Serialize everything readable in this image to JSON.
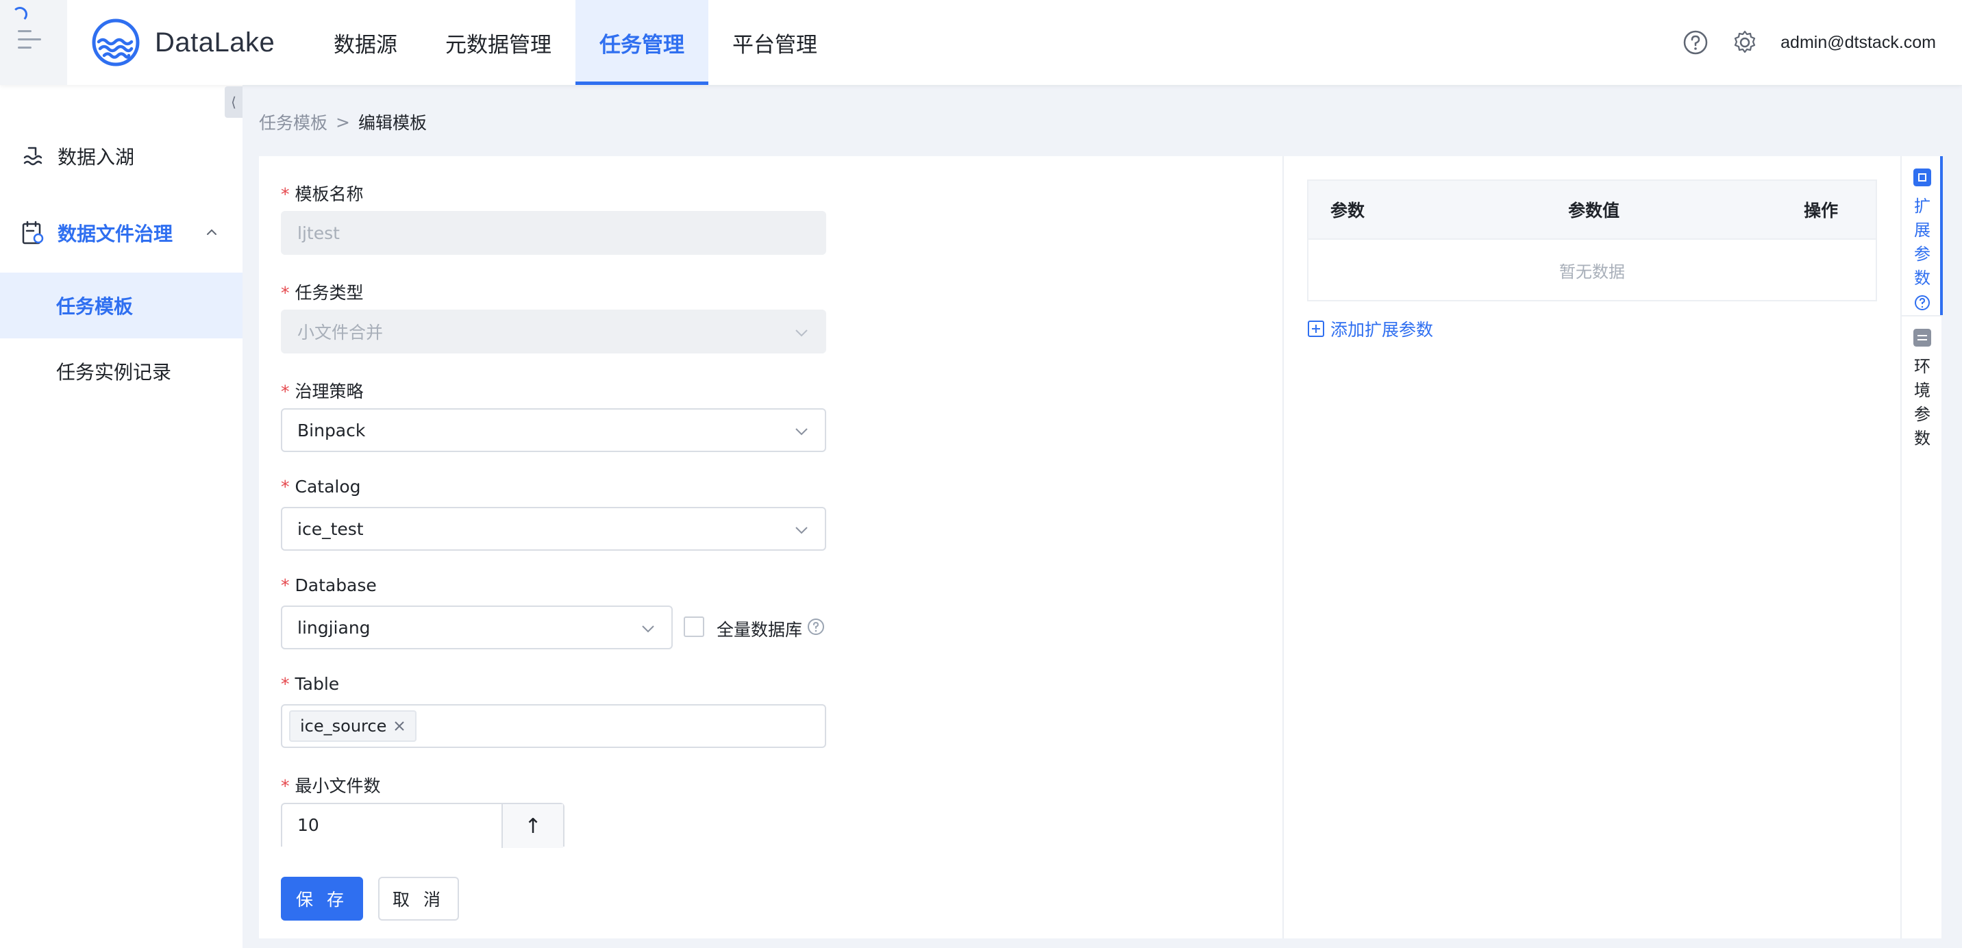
{
  "app": {
    "brand": "DataLake"
  },
  "nav": [
    {
      "label": "数据源",
      "active": false
    },
    {
      "label": "元数据管理",
      "active": false
    },
    {
      "label": "任务管理",
      "active": true
    },
    {
      "label": "平台管理",
      "active": false
    }
  ],
  "header": {
    "user": "admin@dtstack.com"
  },
  "sidebar": {
    "collapse_glyph": "⟨",
    "items": [
      {
        "label": "数据入湖"
      },
      {
        "label": "数据文件治理"
      },
      {
        "label": "任务模板"
      },
      {
        "label": "任务实例记录"
      }
    ]
  },
  "breadcrumb": {
    "parent": "任务模板",
    "separator": ">",
    "current": "编辑模板"
  },
  "form": {
    "required_mark": "*",
    "template_name": {
      "label": "模板名称",
      "value": "ljtest"
    },
    "task_type": {
      "label": "任务类型",
      "value": "小文件合并"
    },
    "strategy": {
      "label": "治理策略",
      "value": "Binpack"
    },
    "catalog": {
      "label": "Catalog",
      "value": "ice_test"
    },
    "database": {
      "label": "Database",
      "value": "lingjiang",
      "all_db_label": "全量数据库",
      "all_db_checked": false
    },
    "table": {
      "label": "Table",
      "tags": [
        "ice_source"
      ]
    },
    "min_files": {
      "label": "最小文件数",
      "value": "10",
      "step_glyph": "↑"
    },
    "save_label": "保 存",
    "cancel_label": "取 消"
  },
  "params": {
    "columns": [
      "参数",
      "参数值",
      "操作"
    ],
    "empty_text": "暂无数据",
    "add_label": "添加扩展参数"
  },
  "side_tabs": [
    {
      "label": "扩展参数",
      "active": true
    },
    {
      "label": "环境参数",
      "active": false
    }
  ],
  "colors": {
    "primary": "#2f6ff0",
    "required": "#e5484d"
  }
}
